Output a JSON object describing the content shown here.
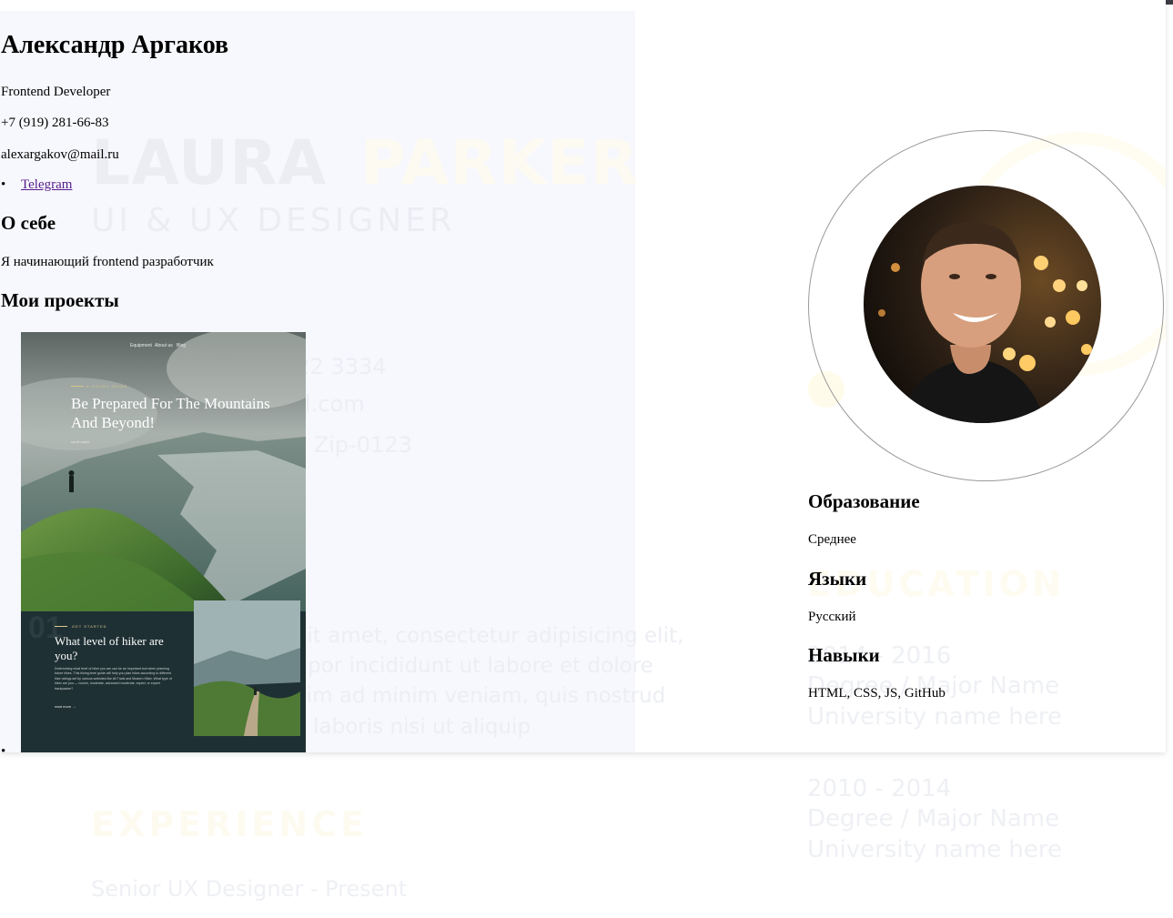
{
  "profile": {
    "name": "Александр Аргаков",
    "job_title": "Frontend Developer",
    "phone": "+7 (919) 281-66-83",
    "email": "alexargakov@mail.ru",
    "links": [
      {
        "label": "Telegram"
      }
    ]
  },
  "about": {
    "heading": "О себе",
    "text": "Я начинающий frontend разработчик"
  },
  "projects": {
    "heading": "Мои проекты",
    "items": [
      {
        "preview": {
          "nav": [
            "Equipment",
            "About us",
            "Blog"
          ],
          "tag": "A HIKING GUIDE",
          "title": "Be Prepared For The Mountains And Beyond!",
          "more": "scroll down",
          "number": "01",
          "section_tag": "GET STARTED",
          "question": "What level of hiker are you?",
          "description": "Determining what level of hiker you are can be an important tool when planning future hikes. This hiking level guide will help you plan hikes according to different hike ratings set by various websites like All Trails and Modern Hiker. What type of hiker are you — novice, moderate, advanced moderate, expert, or expert backpacker?",
          "read_more": "read more →"
        }
      }
    ]
  },
  "sidebar": {
    "education_heading": "Образование",
    "education_text": "Среднее",
    "languages_heading": "Языки",
    "languages_text": "Русский",
    "skills_heading": "Навыки",
    "skills_text": "HTML, CSS, JS, GitHub"
  },
  "background_template": {
    "first_name": "LAURA",
    "last_name": "PARKER",
    "role": "UI & UX DESIGNER",
    "contact_phone": "+000 111 222 3334",
    "contact_email": "name@gmail.com",
    "contact_address": "Address line, Zip-0123",
    "number": "01",
    "lorem_lines": [
      "Lorem ipsum dolor sit amet, consectetur adipisicing elit,",
      "sed do eiusmod tempor incididunt ut labore et dolore",
      "magna aliqua. Ut enim ad minim veniam, quis nostrud",
      "exercitation ullamco laboris nisi ut aliquip"
    ],
    "experience_heading": "EXPERIENCE",
    "experience_item": "Senior UX Designer - Present",
    "education_heading": "EDUCATION",
    "education_rows": [
      "2014 - 2016",
      "Degree / Major Name",
      "University name here",
      "2010 - 2014",
      "Degree / Major Name",
      "University name here"
    ]
  },
  "colors": {
    "link": "#551a8b",
    "left_panel": "#f7f8fd",
    "top_bar": "#3c3c44"
  }
}
